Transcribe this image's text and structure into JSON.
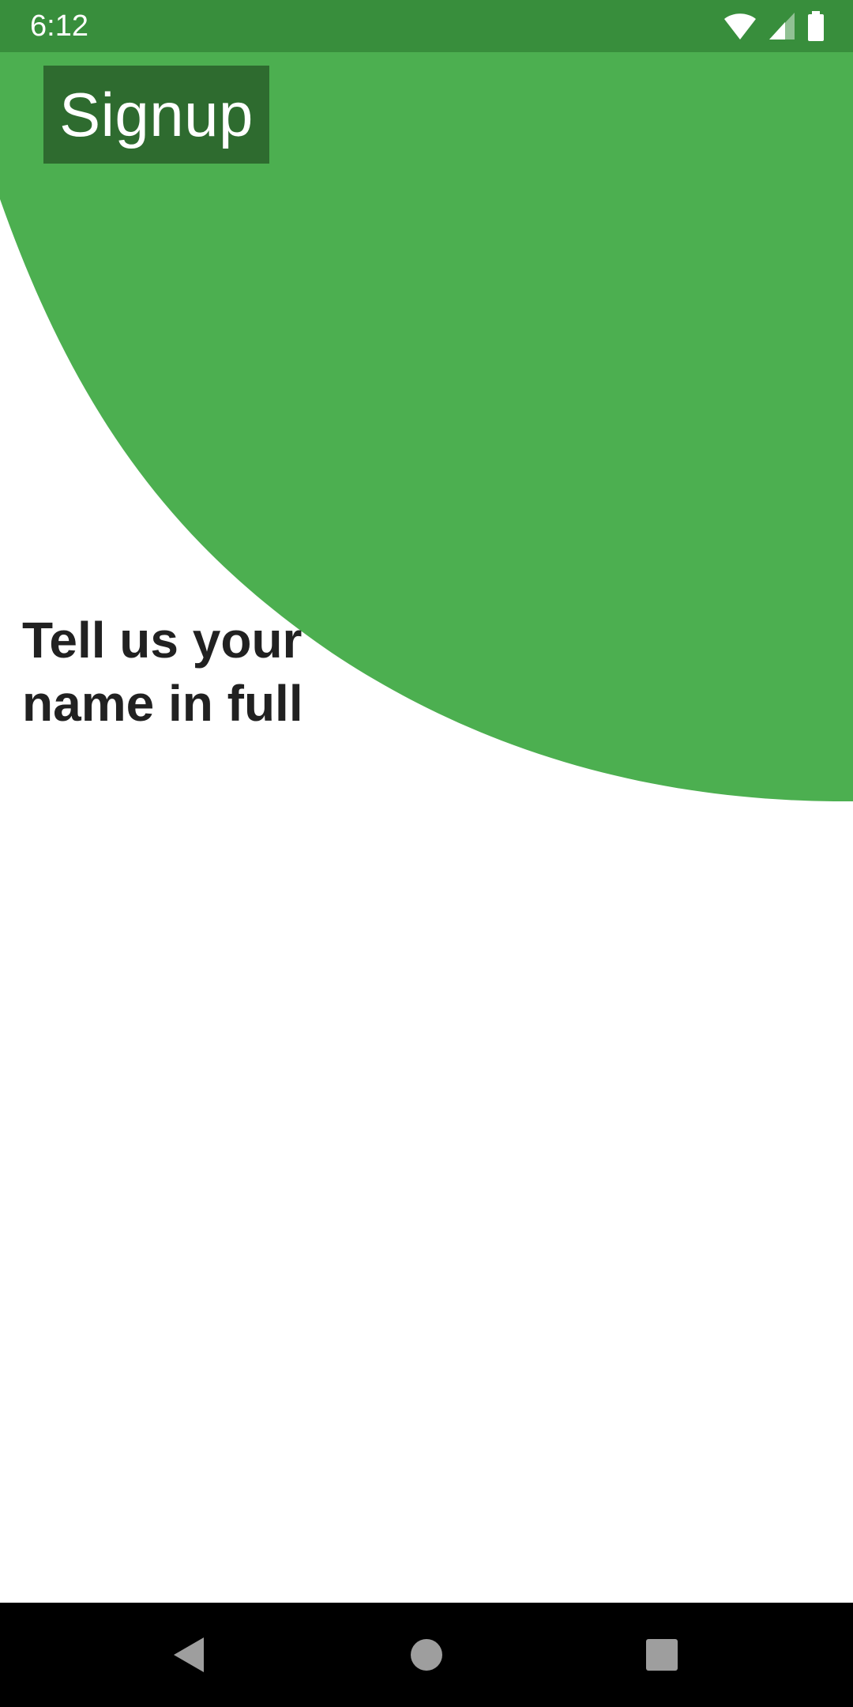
{
  "status_bar": {
    "time": "6:12",
    "icons": [
      "wifi-icon",
      "cell-signal-icon",
      "battery-icon"
    ],
    "background_color": "#388e3c"
  },
  "header": {
    "title": "Signup",
    "accent_color": "#4caf50",
    "title_box_color": "#2e6b2f"
  },
  "content": {
    "prompt": "Tell us your name in full"
  },
  "nav_bar": {
    "buttons": [
      "back-icon",
      "home-icon",
      "recents-icon"
    ]
  }
}
